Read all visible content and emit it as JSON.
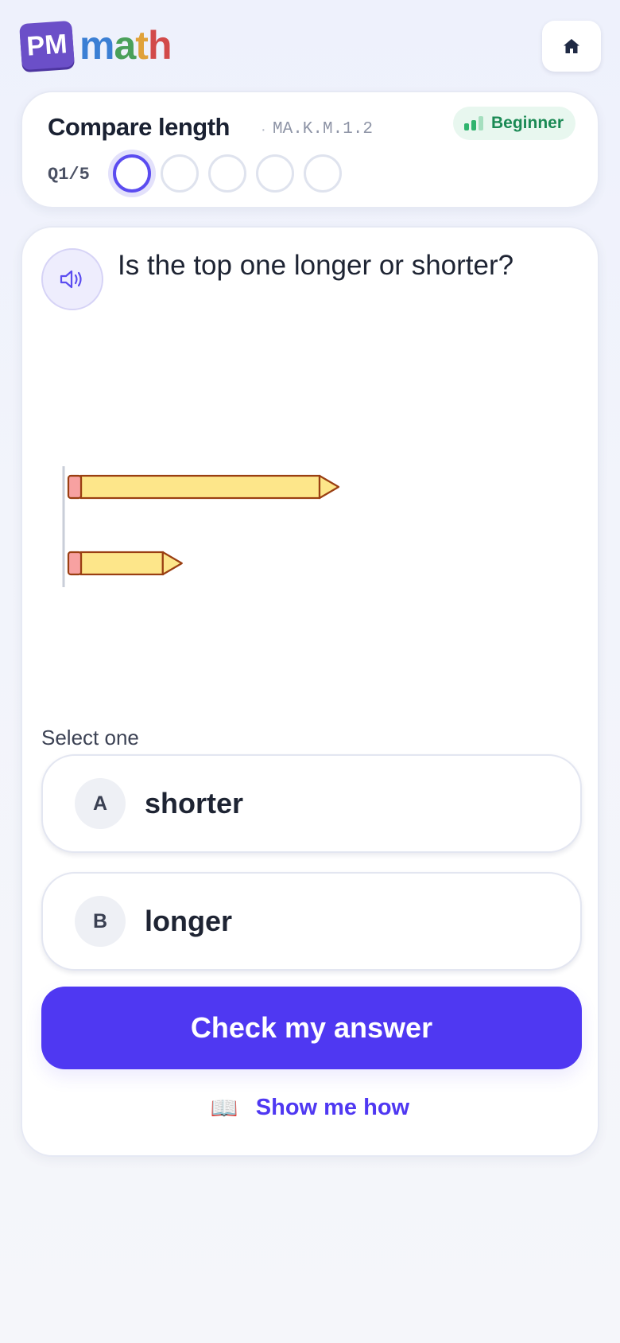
{
  "header": {
    "logo_badge": "PM",
    "logo_word": [
      "m",
      "a",
      "t",
      "h"
    ],
    "home_icon": "home-icon"
  },
  "topic": {
    "title": "Compare length",
    "separator": "·",
    "code": "MA.K.M.1.2",
    "level": "Beginner",
    "question_counter": "Q1/5",
    "progress": {
      "current": 1,
      "total": 5
    }
  },
  "question": {
    "speaker_icon": "speaker-icon",
    "text": "Is the top one longer or shorter?",
    "figure": {
      "items": [
        {
          "label": "top pencil",
          "relative_length": 1.0
        },
        {
          "label": "bottom pencil",
          "relative_length": 0.42
        }
      ]
    },
    "select_label": "Select one",
    "options": [
      {
        "letter": "A",
        "text": "shorter"
      },
      {
        "letter": "B",
        "text": "longer"
      }
    ],
    "check_label": "Check my answer",
    "show_how_icon": "📖",
    "show_how_label": "Show me how"
  },
  "colors": {
    "accent": "#4f38f2",
    "level_green": "#1b8a55",
    "pencil_body": "#fde68a",
    "pencil_outline": "#9a3f12",
    "eraser": "#f7a1a1"
  }
}
